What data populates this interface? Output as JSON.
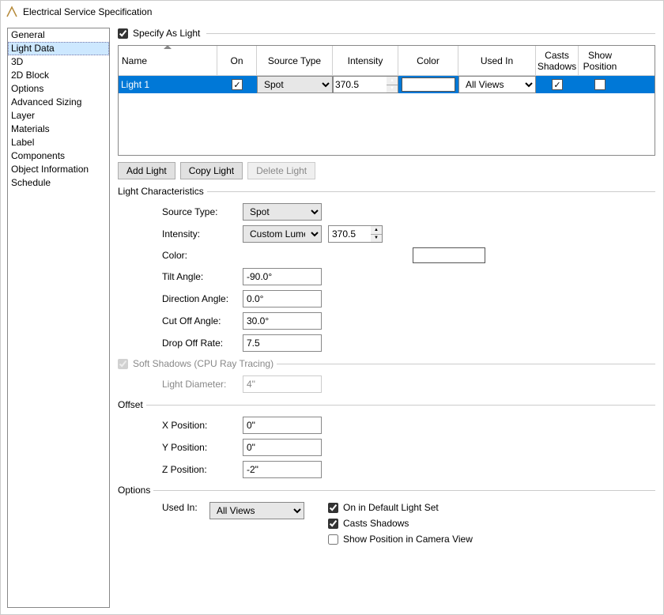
{
  "title": "Electrical Service Specification",
  "sidebar": {
    "selected": 1,
    "items": [
      {
        "label": "General"
      },
      {
        "label": "Light Data"
      },
      {
        "label": "3D"
      },
      {
        "label": "2D Block"
      },
      {
        "label": "Options"
      },
      {
        "label": "Advanced Sizing"
      },
      {
        "label": "Layer"
      },
      {
        "label": "Materials"
      },
      {
        "label": "Label"
      },
      {
        "label": "Components"
      },
      {
        "label": "Object Information"
      },
      {
        "label": "Schedule"
      }
    ]
  },
  "specify_as_light": {
    "label": "Specify As Light",
    "checked": true
  },
  "grid": {
    "headers": {
      "name": "Name",
      "on": "On",
      "source_type": "Source Type",
      "intensity": "Intensity",
      "color": "Color",
      "used_in": "Used In",
      "casts_shadows": "Casts\nShadows",
      "show_position": "Show\nPosition"
    },
    "rows": [
      {
        "name": "Light 1",
        "on": true,
        "source_type": "Spot",
        "intensity": "370.5",
        "color": "#ffffff",
        "used_in": "All Views",
        "casts_shadows": true,
        "show_position": false
      }
    ]
  },
  "buttons": {
    "add": "Add Light",
    "copy": "Copy Light",
    "delete": "Delete Light"
  },
  "light_characteristics": {
    "legend": "Light Characteristics",
    "source_type": {
      "label": "Source Type:",
      "value": "Spot"
    },
    "intensity": {
      "label": "Intensity:",
      "mode": "Custom Lumens",
      "value": "370.5"
    },
    "color": {
      "label": "Color:",
      "value": "#ffffff"
    },
    "tilt_angle": {
      "label": "Tilt Angle:",
      "value": "-90.0°"
    },
    "direction_angle": {
      "label": "Direction Angle:",
      "value": "0.0°"
    },
    "cut_off_angle": {
      "label": "Cut Off Angle:",
      "value": "30.0°"
    },
    "drop_off_rate": {
      "label": "Drop Off Rate:",
      "value": "7.5"
    }
  },
  "soft_shadows": {
    "label": "Soft Shadows (CPU Ray Tracing)",
    "checked": true,
    "light_diameter": {
      "label": "Light Diameter:",
      "value": "4\""
    }
  },
  "offset": {
    "legend": "Offset",
    "x": {
      "label": "X Position:",
      "value": "0\""
    },
    "y": {
      "label": "Y Position:",
      "value": "0\""
    },
    "z": {
      "label": "Z Position:",
      "value": "-2\""
    }
  },
  "options": {
    "legend": "Options",
    "used_in": {
      "label": "Used In:",
      "value": "All Views"
    },
    "on_in_default": {
      "label": "On in Default Light Set",
      "checked": true
    },
    "casts_shadows": {
      "label": "Casts Shadows",
      "checked": true
    },
    "show_position": {
      "label": "Show Position in Camera View",
      "checked": false
    }
  }
}
